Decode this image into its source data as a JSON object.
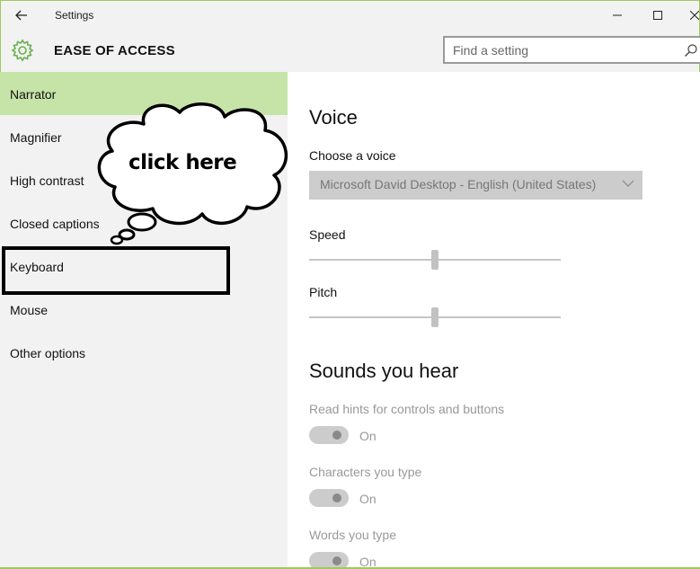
{
  "window": {
    "title": "Settings",
    "back_icon": "arrow-left",
    "controls": [
      "minimize",
      "maximize",
      "close"
    ]
  },
  "header": {
    "icon": "gear-icon",
    "title": "EASE OF ACCESS",
    "accent": "#9ccb5e"
  },
  "search": {
    "placeholder": "Find a setting"
  },
  "sidebar": {
    "selected_color": "#c6e4a8",
    "items": [
      {
        "label": "Narrator",
        "selected": true
      },
      {
        "label": "Magnifier",
        "selected": false
      },
      {
        "label": "High contrast",
        "selected": false
      },
      {
        "label": "Closed captions",
        "selected": false
      },
      {
        "label": "Keyboard",
        "selected": false
      },
      {
        "label": "Mouse",
        "selected": false
      },
      {
        "label": "Other options",
        "selected": false
      }
    ]
  },
  "annotation": {
    "callout_text": "click here",
    "highlighted_item": "Keyboard"
  },
  "voice": {
    "heading": "Voice",
    "choose_label": "Choose a voice",
    "selected_voice": "Microsoft David Desktop - English (United States)",
    "speed_label": "Speed",
    "speed_value": 0.5,
    "pitch_label": "Pitch",
    "pitch_value": 0.5
  },
  "sounds": {
    "heading": "Sounds you hear",
    "settings": [
      {
        "label": "Read hints for controls and buttons",
        "state": "On"
      },
      {
        "label": "Characters you type",
        "state": "On"
      },
      {
        "label": "Words you type",
        "state": "On"
      }
    ]
  }
}
